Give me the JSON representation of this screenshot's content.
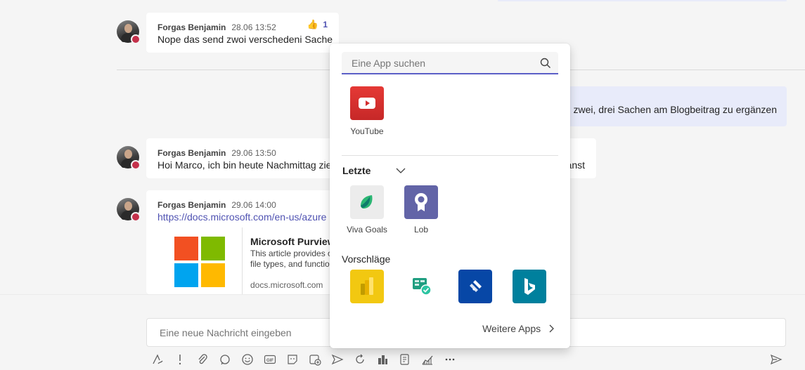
{
  "messages": [
    {
      "author": "Forgas Benjamin",
      "time": "28.06 13:52",
      "text": "Nope das send zwoi verschedeni Sache",
      "reaction": {
        "emoji": "👍",
        "count": "1"
      }
    },
    {
      "author": "Forgas Benjamin",
      "time": "29.06 13:50",
      "text": "Hoi Marco, ich bin heute Nachmittag zie",
      "text_tail": "anst"
    },
    {
      "author": "Forgas Benjamin",
      "time": "29.06 14:00",
      "link": "https://docs.microsoft.com/en-us/azure",
      "preview": {
        "title": "Microsoft Purview",
        "desc_line1": "This article provides o",
        "desc_line2": "file types, and functio",
        "domain": "docs.microsoft.com"
      }
    }
  ],
  "self_message_tail": "h zwei, drei Sachen am Blogbeitrag zu ergänzen",
  "compose": {
    "placeholder": "Eine neue Nachricht eingeben"
  },
  "app_picker": {
    "search_placeholder": "Eine App suchen",
    "result": {
      "label": "YouTube",
      "color": "#d32e2e"
    },
    "recent_title": "Letzte",
    "recent": [
      {
        "label": "Viva Goals",
        "color": "#ececec"
      },
      {
        "label": "Lob",
        "color": "#6264a7"
      }
    ],
    "suggestions_title": "Vorschläge",
    "suggestions": [
      {
        "name": "power-bi",
        "color": "#f2c811"
      },
      {
        "name": "approvals",
        "color": "#ffffff"
      },
      {
        "name": "jira",
        "color": "#0747a6"
      },
      {
        "name": "bing",
        "color": "#00809d"
      }
    ],
    "more_label": "Weitere Apps"
  },
  "toolbar": [
    "format",
    "important",
    "attach",
    "loop",
    "emoji",
    "gif",
    "sticker",
    "schedule-meeting",
    "send-praise",
    "loop-refresh",
    "app-1",
    "app-2",
    "stream",
    "more"
  ],
  "colors": {
    "accent": "#5b5fc7",
    "status_busy": "#c4314b"
  }
}
